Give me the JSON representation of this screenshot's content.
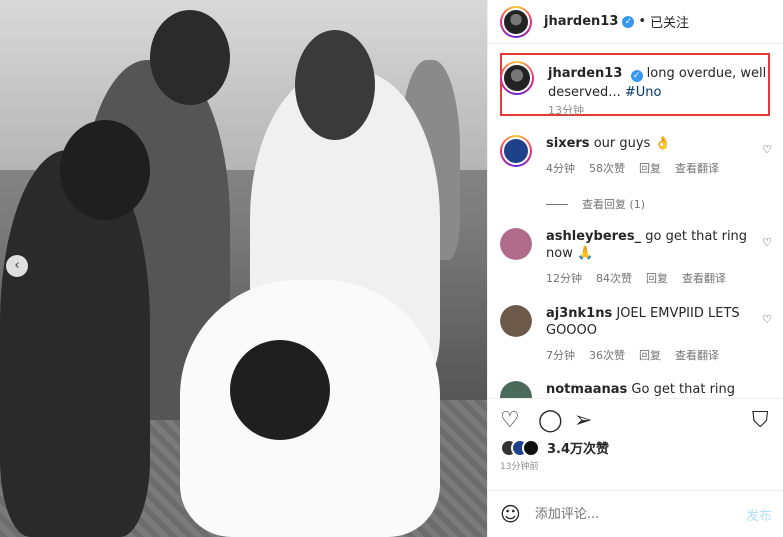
{
  "post": {
    "photo_alt": "",
    "nav_prev": "‹"
  },
  "header": {
    "username": "jharden13",
    "verified_mark": "✓",
    "dot": "•",
    "follow_status": "已关注"
  },
  "caption": {
    "username": "jharden13",
    "verified_mark": "✓",
    "text": "long overdue, well deserved...",
    "hashtag": "#Uno",
    "time": "13分钟"
  },
  "comments": [
    {
      "username": "sixers",
      "text": "our guys 👌",
      "time": "4分钟",
      "likes": "58次赞",
      "reply": "回复",
      "translate": "查看翻译",
      "avatar_color": "#1d428a"
    },
    {
      "username": "ashleyberes_",
      "text": "go get that ring now 🙏",
      "time": "12分钟",
      "likes": "84次赞",
      "reply": "回复",
      "translate": "查看翻译",
      "avatar_color": "#b06a8a"
    },
    {
      "username": "aj3nk1ns",
      "text": "JOEL EMVPIID LETS GOOOO",
      "time": "7分钟",
      "likes": "36次赞",
      "reply": "回复",
      "translate": "查看翻译",
      "avatar_color": "#6e5a4a"
    },
    {
      "username": "notmaanas",
      "text": "Go get that ring king",
      "avatar_color": "#4a6a5a"
    }
  ],
  "view_replies": "查看回复 (1)",
  "icons": {
    "heart": "♡",
    "comment": "◯",
    "share": "➢",
    "save": "⛉",
    "smile": "☺",
    "small_heart": "♡"
  },
  "likes": "3.4万次赞",
  "time_ago": "13分钟前",
  "input": {
    "placeholder": "添加评论...",
    "post_label": "发布"
  },
  "colors": {
    "highlight_box": "#e53935",
    "verified": "#3897f0",
    "hashtag": "#00376b"
  }
}
